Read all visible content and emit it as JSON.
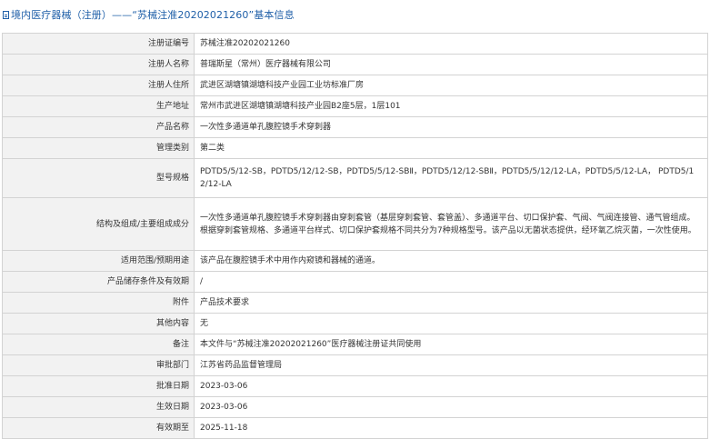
{
  "header": {
    "title": "境内医疗器械（注册）——“苏械注准20202021260”基本信息"
  },
  "rows": [
    {
      "label": "注册证编号",
      "value": "苏械注准20202021260"
    },
    {
      "label": "注册人名称",
      "value": "普瑞斯星（常州）医疗器械有限公司"
    },
    {
      "label": "注册人住所",
      "value": "武进区湖塘镇湖塘科技产业园工业坊标准厂房"
    },
    {
      "label": "生产地址",
      "value": "常州市武进区湖塘镇湖塘科技产业园B2座5层，1层101"
    },
    {
      "label": "产品名称",
      "value": "一次性多通道单孔腹腔镜手术穿刺器"
    },
    {
      "label": "管理类别",
      "value": "第二类"
    },
    {
      "label": "型号规格",
      "value": "PDTD5/5/12-SB，PDTD5/12/12-SB，PDTD5/5/12-SBⅡ，PDTD5/12/12-SBⅡ，PDTD5/5/12/12-LA，PDTD5/5/12-LA， PDTD5/12/12-LA"
    },
    {
      "label": "结构及组成/主要组成成分",
      "value": "一次性多通道单孔腹腔镜手术穿刺器由穿刺套管（基层穿刺套管、套管盖）、多通道平台、切口保护套、气阀、气阀连接管、通气管组成。根据穿刺套管规格、多通道平台样式、切口保护套规格不同共分为7种规格型号。该产品以无菌状态提供，经环氧乙烷灭菌，一次性使用。"
    },
    {
      "label": "适用范围/预期用途",
      "value": "该产品在腹腔镜手术中用作内窥镜和器械的通道。"
    },
    {
      "label": "产品储存条件及有效期",
      "value": "/"
    },
    {
      "label": "附件",
      "value": "产品技术要求"
    },
    {
      "label": "其他内容",
      "value": "无"
    },
    {
      "label": "备注",
      "value": "本文件与“苏械注准20202021260”医疗器械注册证共同使用"
    },
    {
      "label": "审批部门",
      "value": "江苏省药品监督管理局"
    },
    {
      "label": "批准日期",
      "value": "2023-03-06"
    },
    {
      "label": "生效日期",
      "value": "2023-03-06"
    },
    {
      "label": "有效期至",
      "value": "2025-11-18"
    }
  ]
}
